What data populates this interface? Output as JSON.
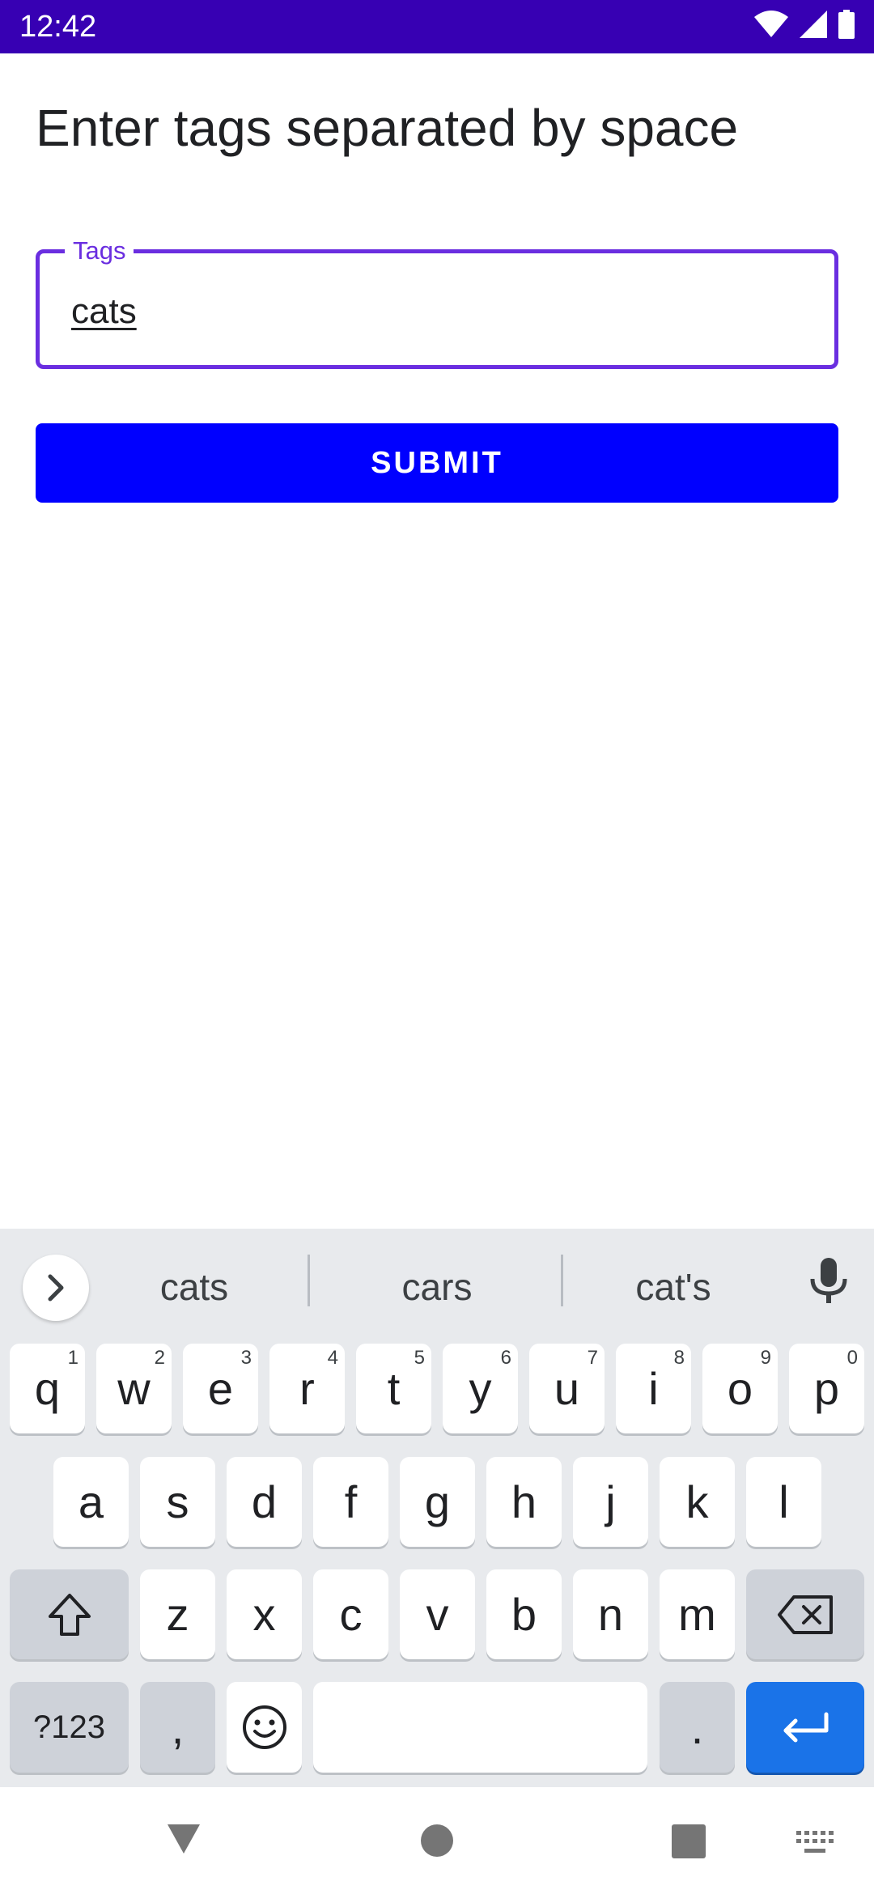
{
  "status_bar": {
    "time": "12:42"
  },
  "page": {
    "title": "Enter tags separated by space"
  },
  "tags_field": {
    "label": "Tags",
    "value": "cats"
  },
  "submit_button": {
    "label": "SUBMIT"
  },
  "keyboard": {
    "suggestions": [
      "cats",
      "cars",
      "cat's"
    ],
    "row1": [
      {
        "key": "q",
        "hint": "1"
      },
      {
        "key": "w",
        "hint": "2"
      },
      {
        "key": "e",
        "hint": "3"
      },
      {
        "key": "r",
        "hint": "4"
      },
      {
        "key": "t",
        "hint": "5"
      },
      {
        "key": "y",
        "hint": "6"
      },
      {
        "key": "u",
        "hint": "7"
      },
      {
        "key": "i",
        "hint": "8"
      },
      {
        "key": "o",
        "hint": "9"
      },
      {
        "key": "p",
        "hint": "0"
      }
    ],
    "row2": [
      "a",
      "s",
      "d",
      "f",
      "g",
      "h",
      "j",
      "k",
      "l"
    ],
    "row3": [
      "z",
      "x",
      "c",
      "v",
      "b",
      "n",
      "m"
    ],
    "symbols_label": "?123",
    "comma": ",",
    "period": "."
  },
  "colors": {
    "status_bar": "#3700b3",
    "accent": "#6a2ee0",
    "button": "#0000ff",
    "enter_key": "#1a73e8"
  }
}
